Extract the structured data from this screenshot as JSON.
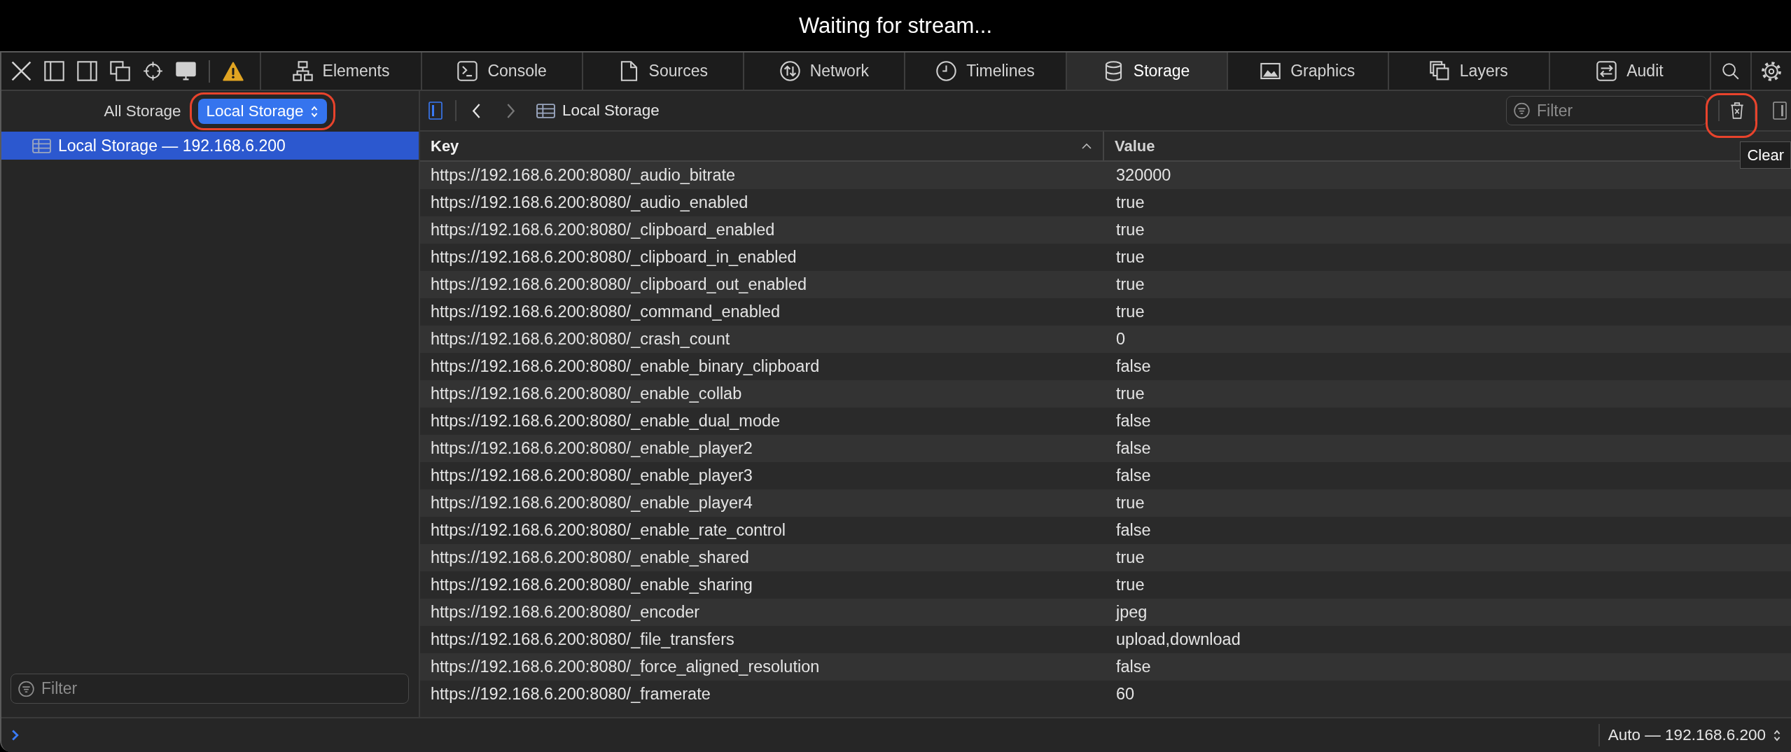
{
  "window": {
    "title": "Waiting for stream..."
  },
  "tabs": [
    {
      "label": "Elements",
      "selected": false
    },
    {
      "label": "Console",
      "selected": false
    },
    {
      "label": "Sources",
      "selected": false
    },
    {
      "label": "Network",
      "selected": false
    },
    {
      "label": "Timelines",
      "selected": false
    },
    {
      "label": "Storage",
      "selected": true
    },
    {
      "label": "Graphics",
      "selected": false
    },
    {
      "label": "Layers",
      "selected": false
    },
    {
      "label": "Audit",
      "selected": false
    }
  ],
  "sidebar": {
    "scopes": [
      {
        "label": "All Storage",
        "selected": false,
        "annotated": false
      },
      {
        "label": "Local Storage",
        "selected": true,
        "annotated": true
      }
    ],
    "items": [
      {
        "label": "Local Storage — 192.168.6.200",
        "selected": true
      }
    ],
    "filter": {
      "placeholder": "Filter"
    }
  },
  "navigation": {
    "sidebar_toggle": {
      "on": true
    },
    "back": {
      "disabled": false
    },
    "forward": {
      "disabled": true
    },
    "breadcrumb": "Local Storage",
    "filter": {
      "placeholder": "Filter"
    },
    "clear_button": {
      "tooltip": "Clear",
      "annotated": true
    },
    "details_toggle": {
      "on": false
    }
  },
  "table": {
    "columns": [
      {
        "label": "Key",
        "sorted": true
      },
      {
        "label": "Value",
        "sorted": false
      }
    ],
    "rows": [
      {
        "key": "https://192.168.6.200:8080/_audio_bitrate",
        "value": "320000"
      },
      {
        "key": "https://192.168.6.200:8080/_audio_enabled",
        "value": "true"
      },
      {
        "key": "https://192.168.6.200:8080/_clipboard_enabled",
        "value": "true"
      },
      {
        "key": "https://192.168.6.200:8080/_clipboard_in_enabled",
        "value": "true"
      },
      {
        "key": "https://192.168.6.200:8080/_clipboard_out_enabled",
        "value": "true"
      },
      {
        "key": "https://192.168.6.200:8080/_command_enabled",
        "value": "true"
      },
      {
        "key": "https://192.168.6.200:8080/_crash_count",
        "value": "0"
      },
      {
        "key": "https://192.168.6.200:8080/_enable_binary_clipboard",
        "value": "false"
      },
      {
        "key": "https://192.168.6.200:8080/_enable_collab",
        "value": "true"
      },
      {
        "key": "https://192.168.6.200:8080/_enable_dual_mode",
        "value": "false"
      },
      {
        "key": "https://192.168.6.200:8080/_enable_player2",
        "value": "false"
      },
      {
        "key": "https://192.168.6.200:8080/_enable_player3",
        "value": "false"
      },
      {
        "key": "https://192.168.6.200:8080/_enable_player4",
        "value": "true"
      },
      {
        "key": "https://192.168.6.200:8080/_enable_rate_control",
        "value": "false"
      },
      {
        "key": "https://192.168.6.200:8080/_enable_shared",
        "value": "true"
      },
      {
        "key": "https://192.168.6.200:8080/_enable_sharing",
        "value": "true"
      },
      {
        "key": "https://192.168.6.200:8080/_encoder",
        "value": "jpeg"
      },
      {
        "key": "https://192.168.6.200:8080/_file_transfers",
        "value": "upload,download"
      },
      {
        "key": "https://192.168.6.200:8080/_force_aligned_resolution",
        "value": "false"
      },
      {
        "key": "https://192.168.6.200:8080/_framerate",
        "value": "60"
      }
    ]
  },
  "status_bar": {
    "target": "Auto — 192.168.6.200"
  }
}
